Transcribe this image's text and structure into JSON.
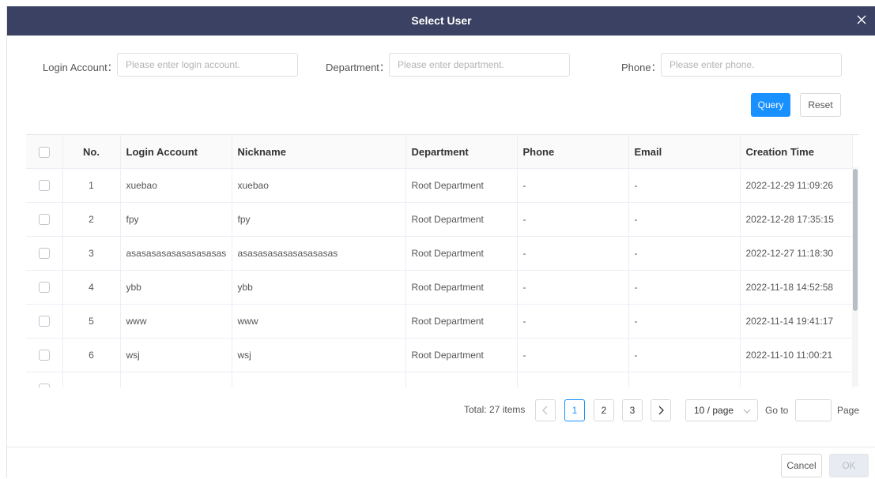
{
  "dialog": {
    "title": "Select User"
  },
  "filters": {
    "login_label": "Login Account：",
    "login_placeholder": "Please enter login account.",
    "dept_label": "Department：",
    "dept_placeholder": "Please enter department.",
    "phone_label": "Phone：",
    "phone_placeholder": "Please enter phone.",
    "query_label": "Query",
    "reset_label": "Reset"
  },
  "table": {
    "headers": [
      "No.",
      "Login Account",
      "Nickname",
      "Department",
      "Phone",
      "Email",
      "Creation Time"
    ],
    "rows": [
      [
        "1",
        "xuebao",
        "xuebao",
        "Root Department",
        "-",
        "-",
        "2022-12-29 11:09:26"
      ],
      [
        "2",
        "fpy",
        "fpy",
        "Root Department",
        "-",
        "-",
        "2022-12-28 17:35:15"
      ],
      [
        "3",
        "asasasasasasasasasas",
        "asasasasasasasasasas",
        "Root Department",
        "-",
        "-",
        "2022-12-27 11:18:30"
      ],
      [
        "4",
        "ybb",
        "ybb",
        "Root Department",
        "-",
        "-",
        "2022-11-18 14:52:58"
      ],
      [
        "5",
        "www",
        "www",
        "Root Department",
        "-",
        "-",
        "2022-11-14 19:41:17"
      ],
      [
        "6",
        "wsj",
        "wsj",
        "Root Department",
        "-",
        "-",
        "2022-11-10 11:00:21"
      ],
      [
        "",
        "",
        "",
        "",
        "",
        "",
        ""
      ]
    ]
  },
  "pagination": {
    "total": "Total: 27 items",
    "pages": [
      "1",
      "2",
      "3"
    ],
    "per_page": "10 / page",
    "goto_label": "Go to",
    "page_label": "Page"
  },
  "footer": {
    "cancel_label": "Cancel",
    "ok_label": "OK"
  },
  "colors": {
    "header_bg": "#3a4162",
    "primary": "#1890ff"
  }
}
